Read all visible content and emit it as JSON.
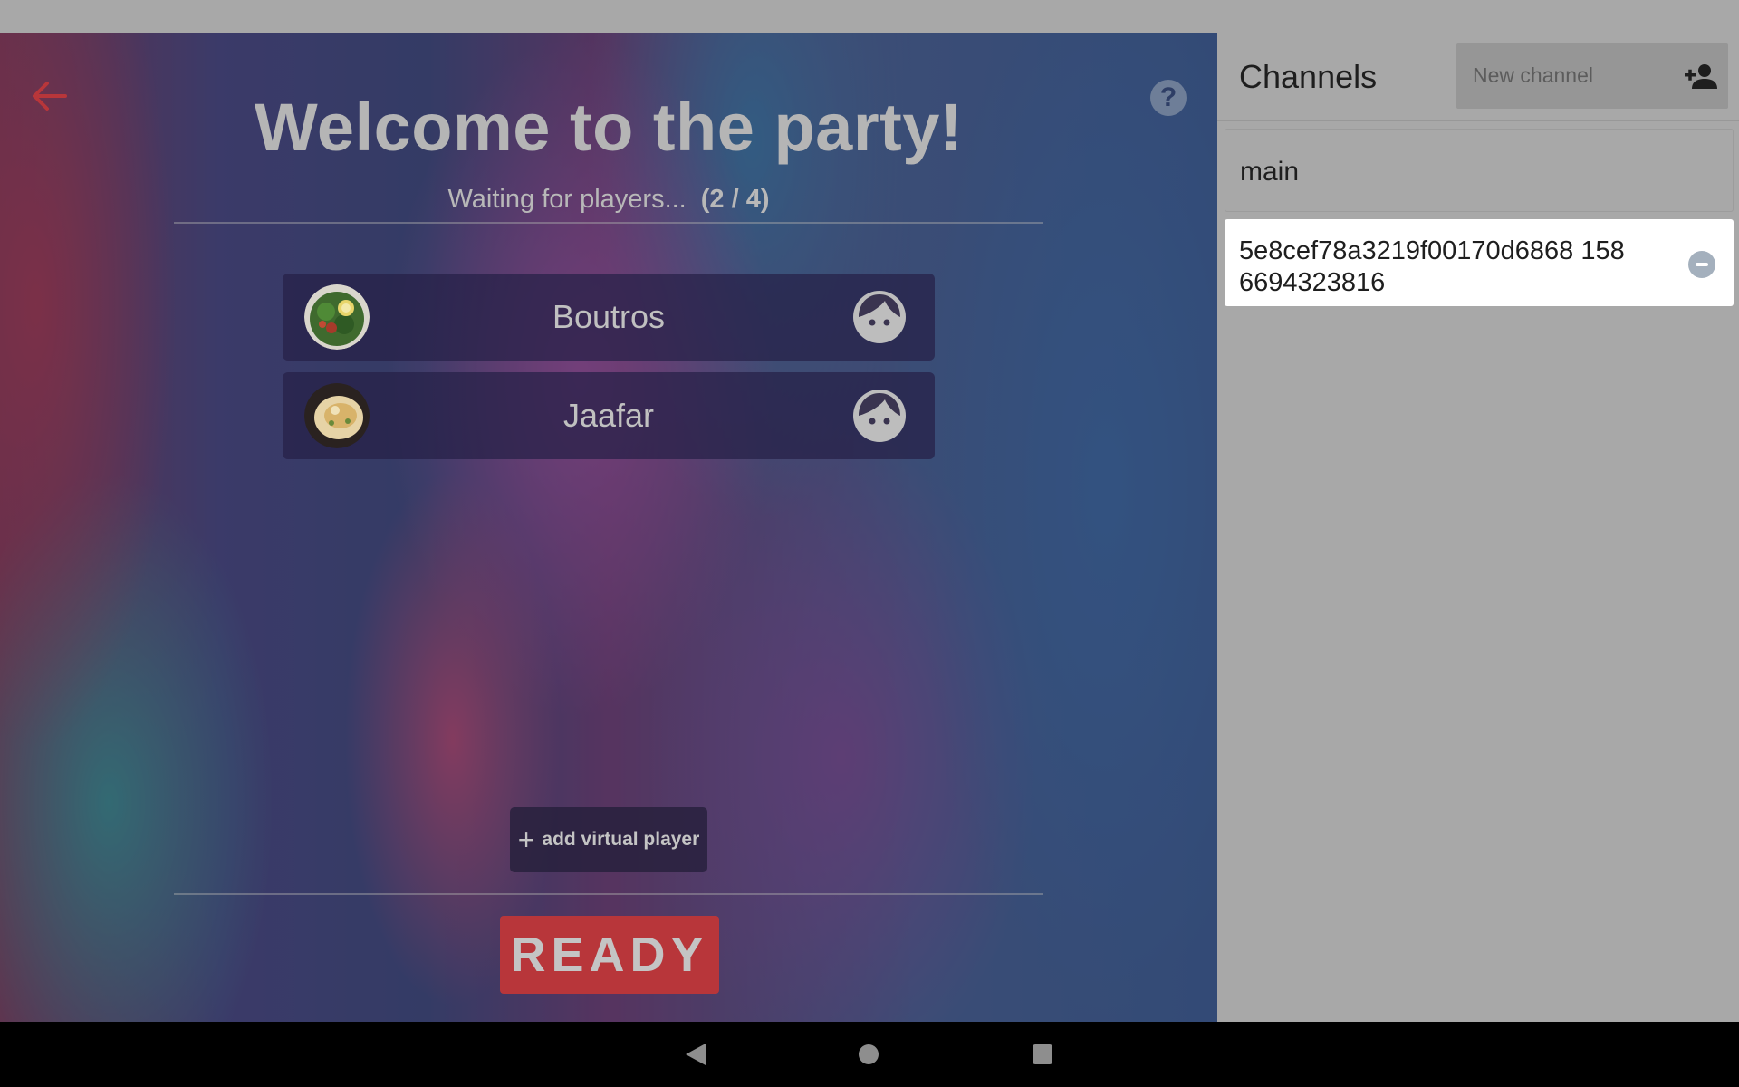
{
  "lobby": {
    "title": "Welcome to the party!",
    "waiting_text": "Waiting for players...",
    "player_count": "(2 / 4)",
    "players": [
      {
        "name": "Boutros",
        "avatar": "salad-food-photo",
        "type_icon": "human-face-icon"
      },
      {
        "name": "Jaafar",
        "avatar": "dish-food-photo",
        "type_icon": "human-face-icon"
      }
    ],
    "add_virtual_player_label": "add virtual player",
    "ready_label": "READY",
    "help_label": "?"
  },
  "channels": {
    "title": "Channels",
    "new_channel_placeholder": "New channel",
    "items": [
      {
        "name": "main",
        "selected": false
      },
      {
        "name": "5e8cef78a3219f00170d6868 1586694323816",
        "selected": true
      }
    ]
  },
  "colors": {
    "accent_red": "#b8363a",
    "panel_bg": "#a8a8a8",
    "selected_channel_bg": "#ffffff"
  }
}
